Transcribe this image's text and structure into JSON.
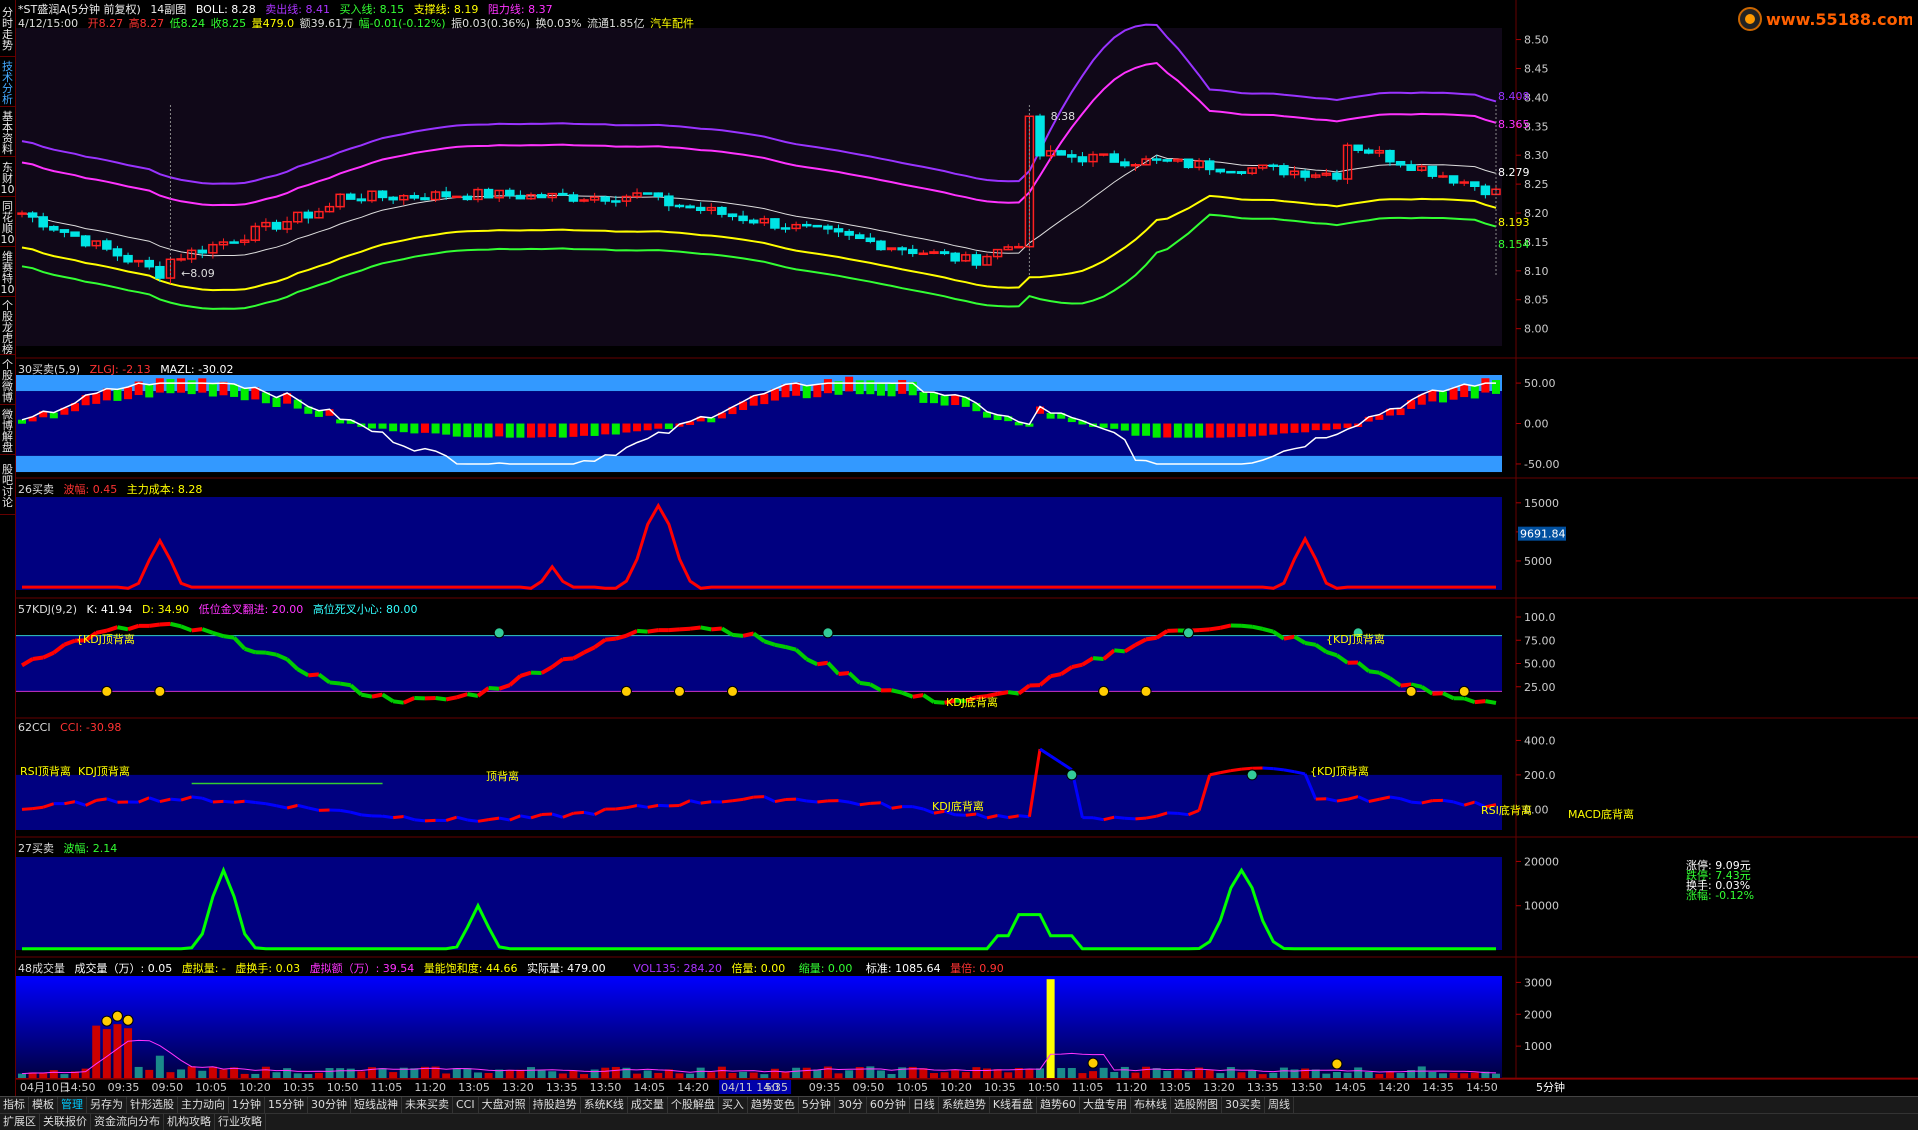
{
  "sidebar_tabs": [
    {
      "label": "分时走势",
      "active": false
    },
    {
      "label": "技术分析",
      "active": true
    },
    {
      "label": "基本资料",
      "active": false
    },
    {
      "label": "东财10",
      "active": false
    },
    {
      "label": "同花顺10",
      "active": false
    },
    {
      "label": "维赛特10",
      "active": false
    },
    {
      "label": "个股龙虎榜",
      "active": false
    },
    {
      "label": "个股微博",
      "active": false
    },
    {
      "label": "微博解盘",
      "active": false
    },
    {
      "label": "股吧讨论",
      "active": false
    }
  ],
  "header": {
    "stock": "*ST盛润A(5分钟 前复权)",
    "subchart": "14副图",
    "boll": "BOLL: 8.28",
    "sell_line": "卖出线: 8.41",
    "buy_line": "买入线: 8.15",
    "support": "支撑线: 8.19",
    "resist": "阻力线: 8.37",
    "date": "4/12/15:00",
    "open": "开8.27",
    "high": "高8.27",
    "low": "低8.24",
    "close": "收8.25",
    "volume": "量479.0",
    "amount": "额39.61万",
    "change": "幅-0.01(-0.12%)",
    "amplitude": "振0.03(0.36%)",
    "turnover": "换0.03%",
    "float": "流通1.85亿",
    "sector": "汽车配件"
  },
  "logo": {
    "text": "www.55188.com"
  },
  "colors": {
    "bg": "#000000",
    "panel_border": "#660000",
    "up": "#ff2020",
    "down": "#00e5e5",
    "upper_band": "#9933ff",
    "sell_band": "#ff33ff",
    "mid_band": "#dddddd",
    "support_band": "#ffff00",
    "lower_band": "#33ff33",
    "panel_fill": "#000080",
    "band_fill": "#3399ff",
    "tag_yellow": "#ffff00"
  },
  "main_panel": {
    "y_ticks": [
      "8.50",
      "8.45",
      "8.40",
      "8.35",
      "8.30",
      "8.25",
      "8.20",
      "8.15",
      "8.10",
      "8.05",
      "8.00"
    ],
    "right_labels": {
      "upper": "8.408",
      "sell": "8.365",
      "mid": "8.279",
      "support": "8.193",
      "lower": "8.154"
    },
    "annotations": {
      "high_mark": "8.38",
      "low_mark": "8.09"
    }
  },
  "panel2": {
    "title": "30买卖(5,9)",
    "zlgj": "ZLGJ: -2.13",
    "mazl": "MAZL: -30.02",
    "y_ticks": [
      "50.00",
      "0.00",
      "-50.00"
    ]
  },
  "panel3": {
    "title": "26买卖",
    "wave": "波幅: 0.45",
    "cost": "主力成本: 8.28",
    "y_ticks": [
      "15000",
      "10000",
      "5000"
    ],
    "marker": "9691.84"
  },
  "panel4": {
    "title": "57KDJ(9,2)",
    "k": "K: 41.94",
    "d": "D: 34.90",
    "low_cross": "低位金叉翻进: 20.00",
    "high_cross": "高位死叉小心: 80.00",
    "y_ticks": [
      "100.0",
      "75.00",
      "50.00",
      "25.00"
    ],
    "tags": [
      "{KDJ顶背离",
      "KDJ底背离",
      "{KDJ顶背离"
    ]
  },
  "panel5": {
    "title": "62CCI",
    "cci": "CCI: -30.98",
    "y_ticks": [
      "400.0",
      "200.0",
      "0.00"
    ],
    "tags": [
      "RSI顶背离",
      "KDJ顶背离",
      "顶背离",
      "KDJ底背离",
      "{KDJ顶背离",
      "RSI底背离",
      "MACD底背离"
    ]
  },
  "panel6": {
    "title": "27买卖",
    "wave": "波幅: 2.14",
    "y_ticks": [
      "20000",
      "10000"
    ],
    "info": [
      "涨停: 9.09元",
      "跌停: 7.43元",
      "换手: 0.03%",
      "涨幅: -0.12%"
    ]
  },
  "panel7": {
    "title": "48成交量",
    "vol": "成交量（万）: 0.05",
    "virtual": "虚拟量: -",
    "v_turn": "虚换手: 0.03",
    "v_amount": "虚拟额（万）: 39.54",
    "saturation": "量能饱和度: 44.66",
    "actual": "实际量: 479.00",
    "vol135": "VOL135: 284.20",
    "multiple": "倍量: 0.00",
    "shrink": "缩量: 0.00",
    "standard": "标准: 1085.64",
    "ratio": "量倍: 0.90",
    "y_ticks": [
      "3000",
      "2000",
      "1000"
    ]
  },
  "time_axis": {
    "labels": [
      "04月10日",
      "14:50",
      "09:35",
      "09:50",
      "10:05",
      "10:20",
      "10:35",
      "10:50",
      "11:05",
      "11:20",
      "13:05",
      "13:20",
      "13:35",
      "13:50",
      "14:05",
      "14:20",
      "04/11 14:35",
      "50",
      "09:35",
      "09:50",
      "10:05",
      "10:20",
      "10:35",
      "10:50",
      "11:05",
      "11:20",
      "13:05",
      "13:20",
      "13:35",
      "13:50",
      "14:05",
      "14:20",
      "14:35",
      "14:50"
    ],
    "period": "5分钟"
  },
  "bottom_tabs": [
    "指标",
    "模板",
    "管理",
    "另存为",
    "针形选股",
    "主力动向",
    "1分钟",
    "15分钟",
    "30分钟",
    "短线战神",
    "未来买卖",
    "CCI",
    "大盘对照",
    "持股趋势",
    "系统K线",
    "成交量",
    "个股解盘",
    "买入",
    "趋势变色",
    "5分钟",
    "30分",
    "60分钟",
    "日线",
    "系统趋势",
    "K线看盘",
    "趋势60",
    "大盘专用",
    "布林线",
    "选股附图",
    "30买卖",
    "周线"
  ],
  "bottom_tabs2": [
    "扩展区",
    "关联报价",
    "资金流向分布",
    "机构攻略",
    "行业攻略"
  ]
}
